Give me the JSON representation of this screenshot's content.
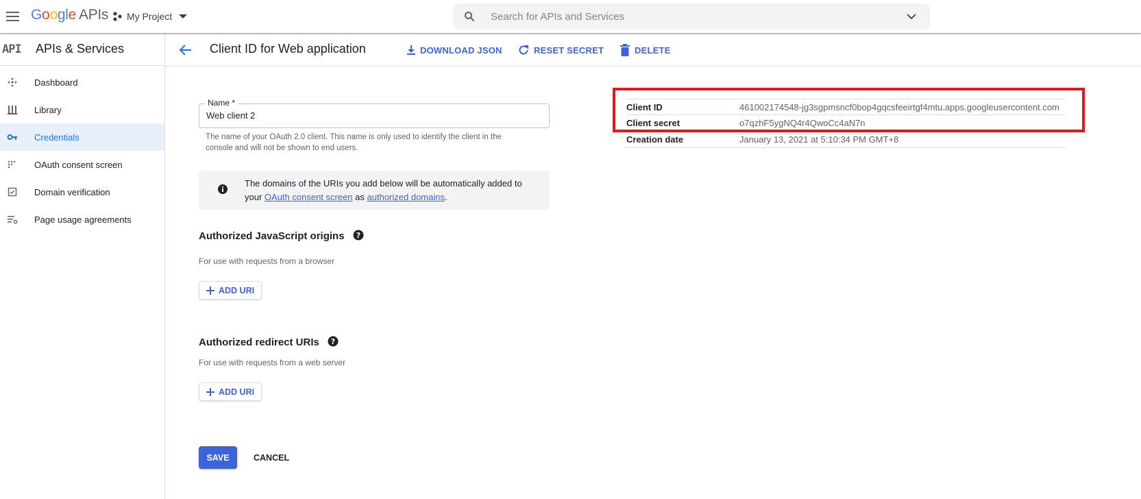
{
  "topbar": {
    "logo_google": [
      "G",
      "o",
      "o",
      "g",
      "l",
      "e"
    ],
    "logo_apis": "APIs",
    "project_name": "My Project",
    "search_placeholder": "Search for APIs and Services"
  },
  "sidebar": {
    "badge": "API",
    "title": "APIs & Services",
    "items": [
      {
        "label": "Dashboard",
        "icon": "dashboard-icon",
        "active": false
      },
      {
        "label": "Library",
        "icon": "library-icon",
        "active": false
      },
      {
        "label": "Credentials",
        "icon": "key-icon",
        "active": true
      },
      {
        "label": "OAuth consent screen",
        "icon": "consent-icon",
        "active": false
      },
      {
        "label": "Domain verification",
        "icon": "checkbox-icon",
        "active": false
      },
      {
        "label": "Page usage agreements",
        "icon": "settings-list-icon",
        "active": false
      }
    ]
  },
  "header": {
    "title": "Client ID for Web application",
    "download_label": "DOWNLOAD JSON",
    "reset_label": "RESET SECRET",
    "delete_label": "DELETE"
  },
  "form": {
    "name_label": "Name *",
    "name_value": "Web client 2",
    "name_hint": "The name of your OAuth 2.0 client. This name is only used to identify the client in the console and will not be shown to end users.",
    "info_text_1": "The domains of the URIs you add below will be automatically added to your ",
    "info_link_1": "OAuth consent screen",
    "info_text_2": " as ",
    "info_link_2": "authorized domains",
    "info_text_3": ".",
    "js_origins_title": "Authorized JavaScript origins",
    "js_origins_sub": "For use with requests from a browser",
    "redirect_title": "Authorized redirect URIs",
    "redirect_sub": "For use with requests from a web server",
    "add_uri_label": "ADD URI",
    "save_label": "SAVE",
    "cancel_label": "CANCEL"
  },
  "details": {
    "rows": [
      {
        "key": "Client ID",
        "value": "461002174548-jg3sgpmsncf0bop4gqcsfeeirtgf4mtu.apps.googleusercontent.com"
      },
      {
        "key": "Client secret",
        "value": "o7qzhF5ygNQ4r4QwoCc4aN7n"
      },
      {
        "key": "Creation date",
        "value": "January 13, 2021 at 5:10:34 PM GMT+8"
      }
    ]
  },
  "colors": {
    "accent": "#3c63d9",
    "highlight": "#e3181b",
    "active_bg": "#e8f0fe"
  }
}
